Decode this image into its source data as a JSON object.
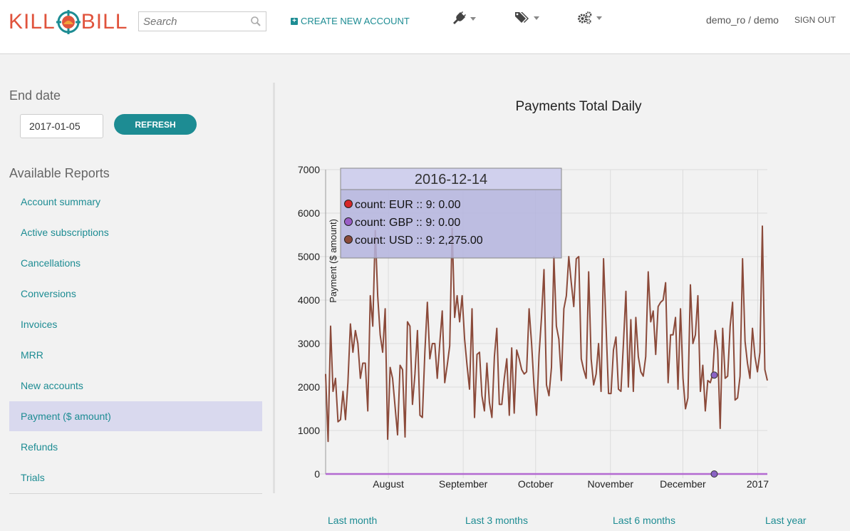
{
  "header": {
    "logo_text": [
      "KILL",
      "BILL"
    ],
    "search_placeholder": "Search",
    "create_label": "CREATE NEW ACCOUNT",
    "menus": [
      "plug-icon",
      "tags-icon",
      "gears-icon"
    ],
    "user": "demo_ro / demo",
    "signout": "SIGN OUT"
  },
  "sidebar": {
    "end_date_title": "End date",
    "end_date_value": "2017-01-05",
    "refresh_label": "REFRESH",
    "reports_title": "Available Reports",
    "reports": [
      "Account summary",
      "Active subscriptions",
      "Cancellations",
      "Conversions",
      "Invoices",
      "MRR",
      "New accounts",
      "Payment ($ amount)",
      "Refunds",
      "Trials"
    ],
    "active_report": "Payment ($ amount)"
  },
  "ranges": [
    "Last month",
    "Last 3 months",
    "Last 6 months",
    "Last year"
  ],
  "colors": {
    "accent": "#1d8c93",
    "usd": "#8b4a3a",
    "gbp": "#9a5ec6",
    "eur": "#d62728"
  },
  "chart_data": {
    "type": "line",
    "title": "Payments Total Daily",
    "ylabel": "Payment ($ amount)",
    "ylim": [
      0,
      7000
    ],
    "yticks": [
      0,
      1000,
      2000,
      3000,
      4000,
      5000,
      6000,
      7000
    ],
    "x_start": "2016-07-06",
    "x_end": "2017-01-05",
    "xtick_labels": [
      "August",
      "September",
      "October",
      "November",
      "December",
      "2017"
    ],
    "xtick_dates": [
      "2016-08-01",
      "2016-09-01",
      "2016-10-01",
      "2016-11-01",
      "2016-12-01",
      "2017-01-01"
    ],
    "series": [
      {
        "name": "EUR",
        "color": "#d62728",
        "values": []
      },
      {
        "name": "GBP",
        "color": "#9a5ec6",
        "values": []
      },
      {
        "name": "USD",
        "color": "#8b4a3a",
        "values": [
          2300,
          750,
          3400,
          1900,
          2200,
          1200,
          1250,
          1900,
          1250,
          2100,
          3450,
          2800,
          3300,
          3000,
          2200,
          2550,
          2550,
          1450,
          4100,
          3400,
          5600,
          4100,
          3200,
          2800,
          3800,
          800,
          2450,
          2200,
          1550,
          900,
          2500,
          2400,
          850,
          3500,
          3400,
          1600,
          2300,
          3300,
          1350,
          1300,
          2800,
          3950,
          2650,
          3000,
          3000,
          2200,
          3000,
          3750,
          2100,
          2500,
          2950,
          5650,
          3600,
          4100,
          3500,
          4100,
          3100,
          2500,
          1950,
          3800,
          1300,
          2750,
          2800,
          1800,
          1450,
          2550,
          1650,
          1300,
          2700,
          3350,
          1600,
          1600,
          2200,
          2650,
          1350,
          2900,
          1400,
          2850,
          2650,
          2400,
          2300,
          2350,
          3800,
          3000,
          2000,
          1350,
          2750,
          3600,
          4700,
          2050,
          1800,
          2450,
          5000,
          3400,
          3100,
          2150,
          3800,
          4100,
          5000,
          4400,
          3850,
          4950,
          5000,
          2650,
          2400,
          2200,
          4650,
          2650,
          2050,
          2300,
          3000,
          1900,
          4950,
          3400,
          1850,
          1850,
          2850,
          3150,
          1950,
          1900,
          3000,
          4200,
          2000,
          3550,
          1900,
          3600,
          2700,
          2350,
          2250,
          2700,
          4650,
          3500,
          3750,
          2750,
          3850,
          3950,
          4000,
          4400,
          2100,
          3200,
          3200,
          3600,
          1950,
          3800,
          2200,
          1500,
          1750,
          4350,
          3000,
          3200,
          4100,
          1900,
          2500,
          1450,
          2150,
          2100,
          2300,
          3300,
          2850,
          1050,
          3350,
          2200,
          2250,
          3400,
          3950,
          1700,
          1750,
          2250,
          4950,
          3050,
          2550,
          2200,
          3350,
          2700,
          2350,
          2800,
          5700,
          2400,
          2150
        ]
      }
    ],
    "tooltip": {
      "date": "2016-12-14",
      "rows": [
        "count: EUR :: 9: 0.00",
        "count: GBP :: 9: 0.00",
        "count: USD :: 9: 2,275.00"
      ]
    }
  }
}
